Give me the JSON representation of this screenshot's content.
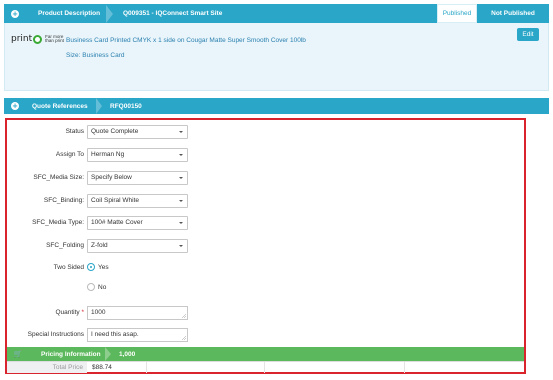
{
  "product_header": {
    "title": "Product Description",
    "job_name": "Q009351 - IQConnect Smart Site",
    "toggle_published": "Published",
    "toggle_not_published": "Not Published"
  },
  "product_body": {
    "logo_text": "print",
    "logo_brand_line1": "Far more",
    "logo_brand_line2": "than print",
    "description": "Business Card Printed CMYK x 1 side on Cougar Matte Super Smooth Cover 100lb",
    "size": "Size: Business Card",
    "edit_label": "Edit"
  },
  "quote_bar": {
    "title": "Quote References",
    "reference": "RFQ00150"
  },
  "form": {
    "status": {
      "label": "Status",
      "value": "Quote Complete"
    },
    "assign_to": {
      "label": "Assign To",
      "value": "Herman Ng"
    },
    "media_size": {
      "label": "SFC_Media Size:",
      "value": "Specify Below"
    },
    "binding": {
      "label": "SFC_Binding:",
      "value": "Coil Spiral White"
    },
    "media_type": {
      "label": "SFC_Media Type:",
      "value": "100# Matte Cover"
    },
    "folding": {
      "label": "SFC_Folding",
      "value": "Z-fold"
    },
    "two_sided": {
      "label": "Two Sided",
      "yes": "Yes",
      "no": "No",
      "selected": "Yes"
    },
    "quantity": {
      "label": "Quantity",
      "required_mark": "*",
      "value": "1000"
    },
    "special_instructions": {
      "label": "Special Instructions",
      "value": "I need this asap."
    }
  },
  "pricing": {
    "title": "Pricing Information",
    "quantity": "1,000",
    "total_label": "Total Price",
    "total_value": "$88.74"
  },
  "colors": {
    "accent": "#2aa6c8",
    "pricing_green": "#5cb85c",
    "highlight_red": "#d9232d"
  }
}
